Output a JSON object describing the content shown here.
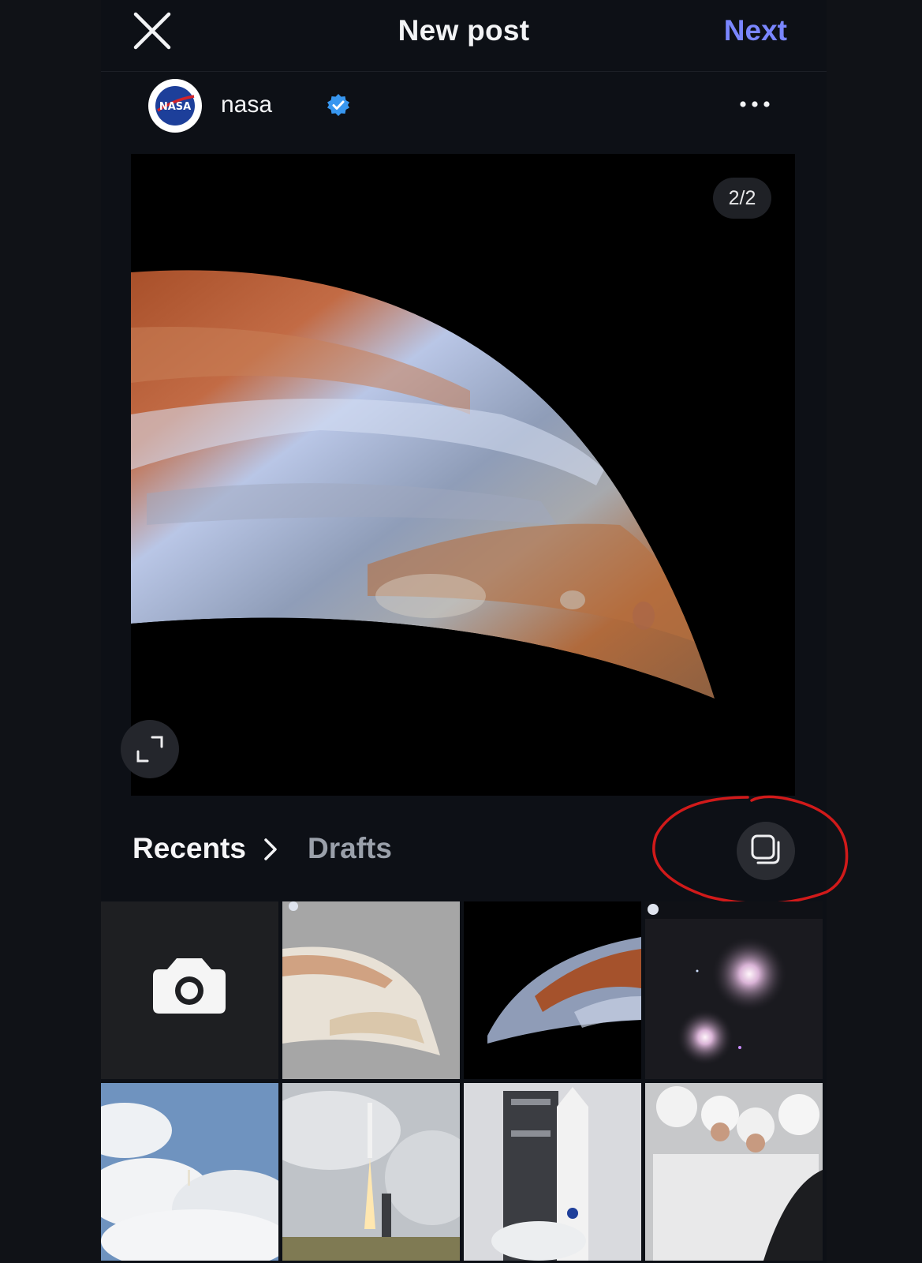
{
  "header": {
    "title": "New post",
    "next_label": "Next"
  },
  "account": {
    "username": "nasa",
    "avatar_text": "NASA"
  },
  "preview": {
    "counter": "2/2"
  },
  "tabs": {
    "recents": "Recents",
    "drafts": "Drafts"
  },
  "colors": {
    "accent": "#7a86ff",
    "verified": "#3897f0",
    "annotation": "#d11a1a"
  },
  "gallery": {
    "tiles": [
      {
        "kind": "camera"
      },
      {
        "kind": "photo",
        "subject": "jupiter-light"
      },
      {
        "kind": "photo",
        "subject": "jupiter-dark"
      },
      {
        "kind": "photo",
        "subject": "galaxies"
      },
      {
        "kind": "photo",
        "subject": "clouds-launch"
      },
      {
        "kind": "photo",
        "subject": "rocket-launch"
      },
      {
        "kind": "photo",
        "subject": "launch-pad"
      },
      {
        "kind": "photo",
        "subject": "astronauts"
      }
    ]
  }
}
